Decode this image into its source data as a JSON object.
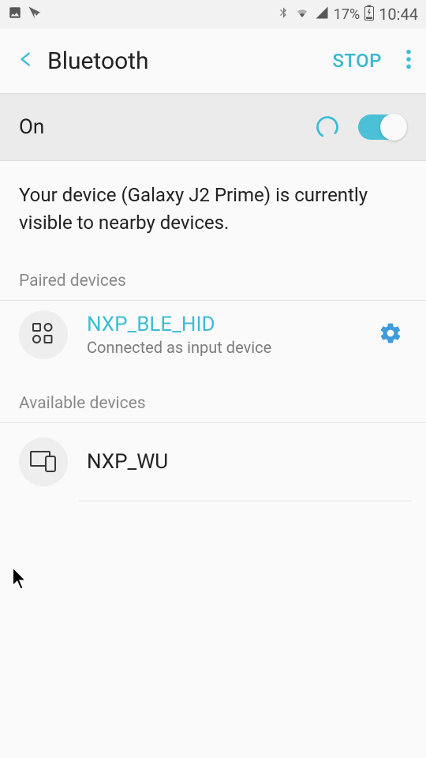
{
  "status_bar": {
    "battery": "17%",
    "time": "10:44"
  },
  "header": {
    "title": "Bluetooth",
    "action": "STOP"
  },
  "toggle": {
    "label": "On",
    "enabled": true
  },
  "visibility_text": "Your device (Galaxy J2 Prime) is currently visible to nearby devices.",
  "sections": {
    "paired_header": "Paired devices",
    "available_header": "Available devices"
  },
  "paired_devices": [
    {
      "name": "NXP_BLE_HID",
      "status": "Connected as input device"
    }
  ],
  "available_devices": [
    {
      "name": "NXP_WU"
    }
  ]
}
